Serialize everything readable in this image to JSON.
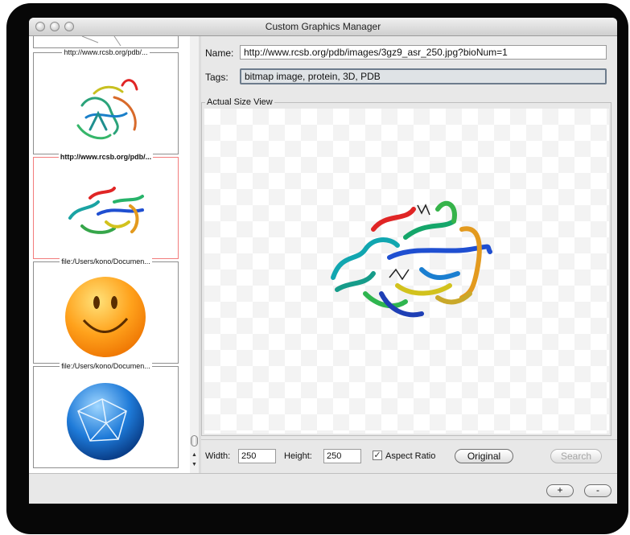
{
  "window": {
    "title": "Custom Graphics Manager"
  },
  "graphics_list": {
    "items": [
      {
        "label": "http://www.rcsb.org/pdb/...",
        "thumb_icon": "protein-structure-icon",
        "selected": false
      },
      {
        "label": "http://www.rcsb.org/pdb/...",
        "thumb_icon": "protein-structure-icon",
        "selected": true
      },
      {
        "label": "file:/Users/kono/Documen...",
        "thumb_icon": "smiley-face-icon",
        "selected": false
      },
      {
        "label": "file:/Users/kono/Documen...",
        "thumb_icon": "network-globe-icon",
        "selected": false
      }
    ]
  },
  "details": {
    "name_label": "Name:",
    "name_value": "http://www.rcsb.org/pdb/images/3gz9_asr_250.jpg?bioNum=1",
    "tags_label": "Tags:",
    "tags_value": "bitmap image, protein, 3D, PDB",
    "preview_title": "Actual Size View",
    "preview_icon": "protein-structure-icon"
  },
  "size_controls": {
    "width_label": "Width:",
    "width_value": "250",
    "height_label": "Height:",
    "height_value": "250",
    "aspect_label": "Aspect Ratio",
    "aspect_checked": true,
    "original_label": "Original",
    "search_label": "Search"
  },
  "footer": {
    "add_label": "+",
    "remove_label": "-"
  },
  "colors": {
    "selection_border": "#f27c7c",
    "tags_focus": "#6d7c8c"
  }
}
